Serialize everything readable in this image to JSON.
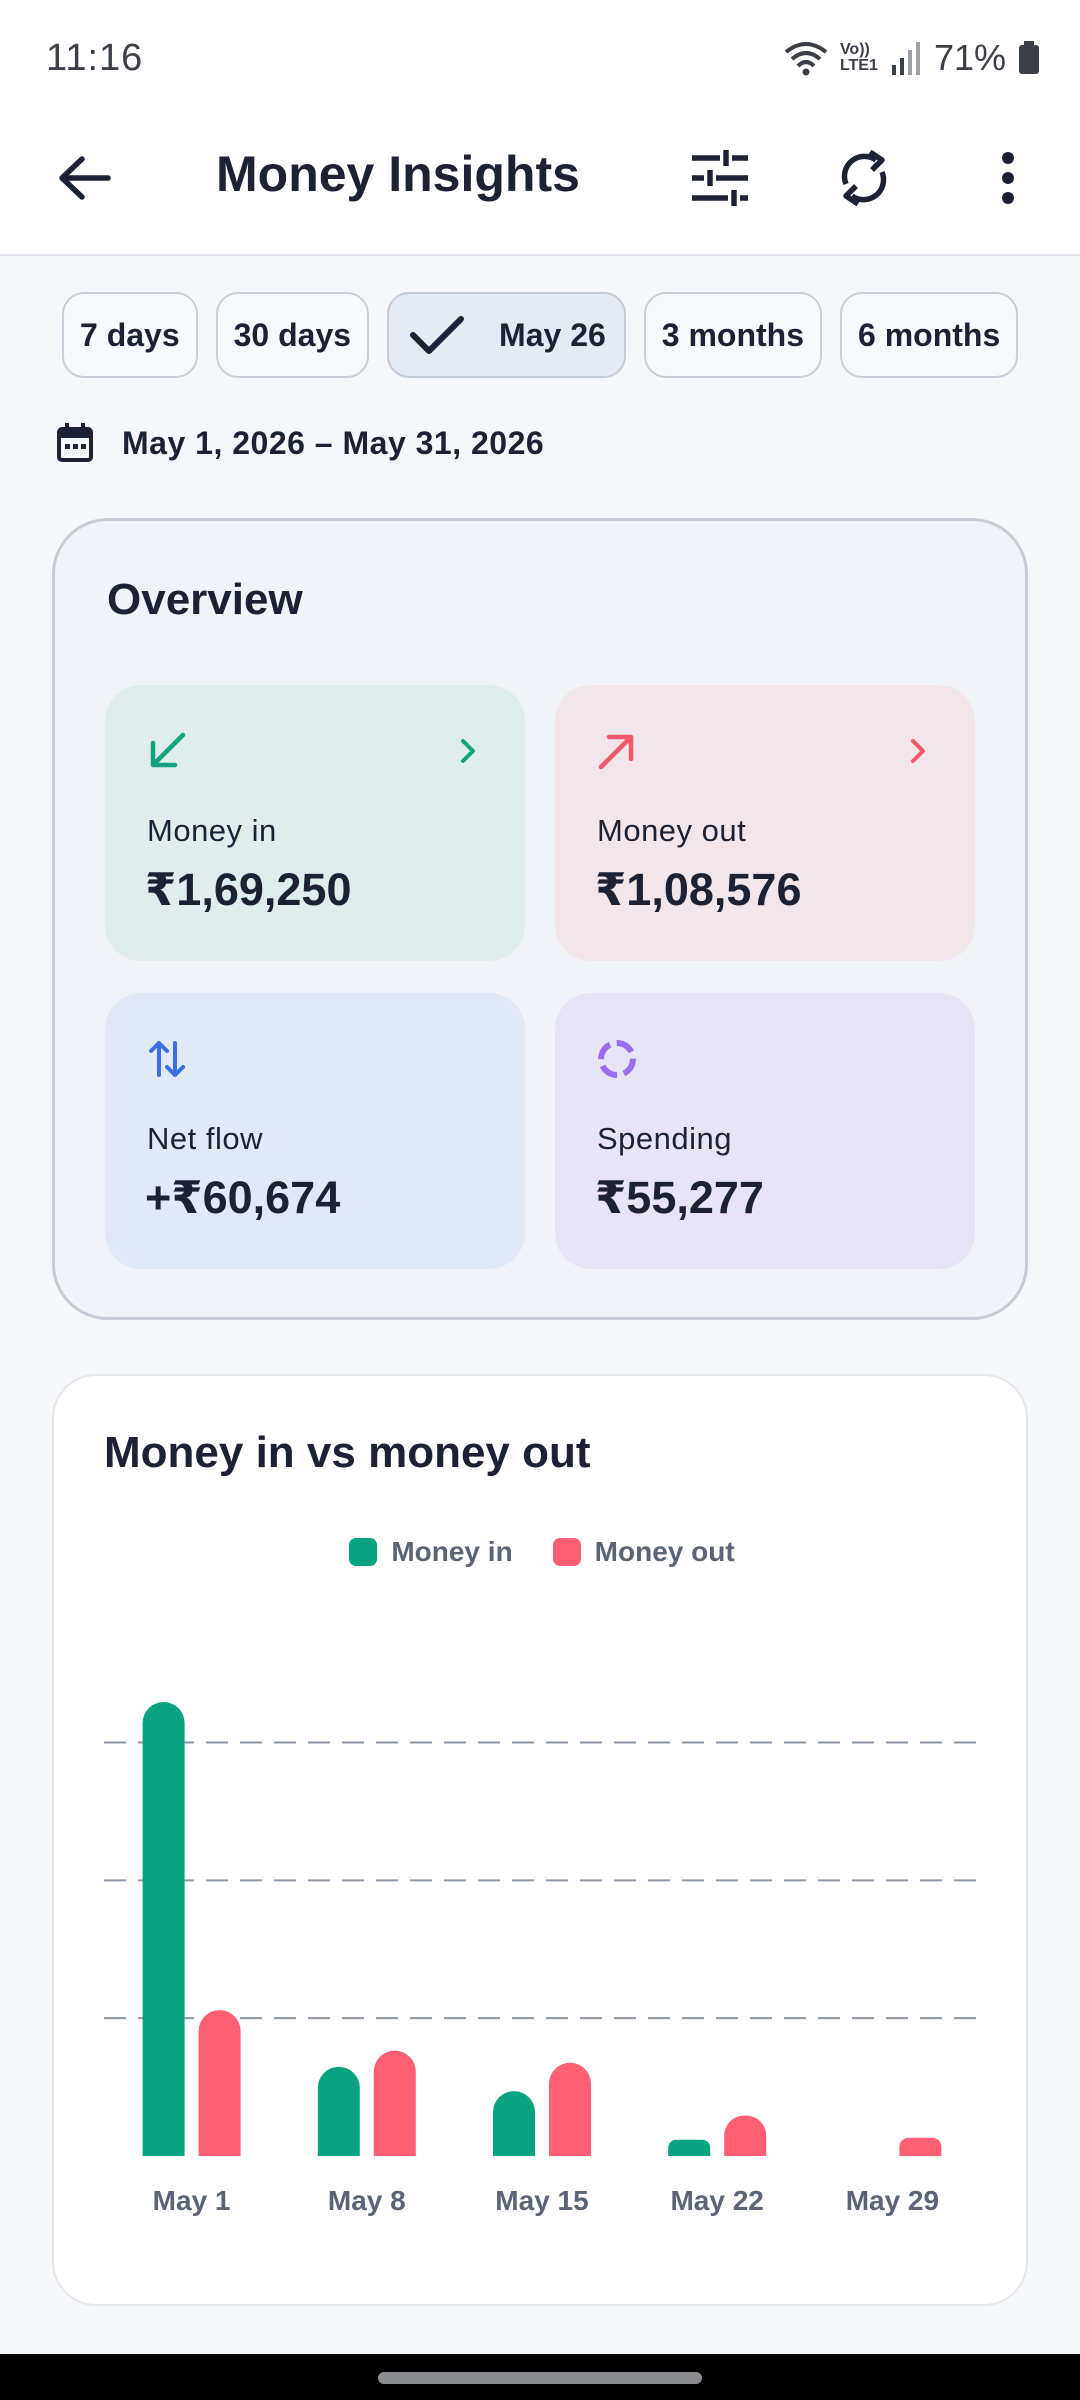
{
  "status_bar": {
    "time": "11:16",
    "network": "Vo)) LTE1",
    "battery": "71%"
  },
  "app_bar": {
    "title": "Money Insights",
    "icons": [
      "back-arrow-icon",
      "filter-sliders-icon",
      "sync-icon",
      "more-vert-icon"
    ]
  },
  "filters": {
    "chips": [
      {
        "label": "7 days",
        "selected": false
      },
      {
        "label": "30 days",
        "selected": false
      },
      {
        "label": "May 26",
        "selected": true
      },
      {
        "label": "3 months",
        "selected": false
      },
      {
        "label": "6 months",
        "selected": false
      }
    ],
    "date_range": "May 1, 2026 – May 31, 2026"
  },
  "overview": {
    "title": "Overview",
    "money_in": {
      "label": "Money in",
      "value": "₹1,69,250",
      "color": "#11a37f"
    },
    "money_out": {
      "label": "Money out",
      "value": "₹1,08,576",
      "color": "#f0586c"
    },
    "net_flow": {
      "label": "Net flow",
      "value": "+₹60,674",
      "color": "#3b6fe0"
    },
    "spending": {
      "label": "Spending",
      "value": "₹55,277",
      "color": "#9a6cf0"
    }
  },
  "chart_card": {
    "title": "Money in vs money out"
  },
  "chart_data": {
    "type": "bar",
    "categories": [
      "May 1",
      "May 8",
      "May 15",
      "May 22",
      "May 29"
    ],
    "series": [
      {
        "name": "Money in",
        "color": "#0aa37f",
        "values": [
          112000,
          22000,
          16000,
          4000,
          0
        ]
      },
      {
        "name": "Money out",
        "color": "#ff5f73",
        "values": [
          36000,
          26000,
          23000,
          10000,
          4500
        ]
      }
    ],
    "ylim": [
      0,
      112000
    ],
    "gridlines": [
      34000,
      68000,
      102000
    ],
    "legend": "top-center",
    "xlabel": "",
    "ylabel": ""
  }
}
